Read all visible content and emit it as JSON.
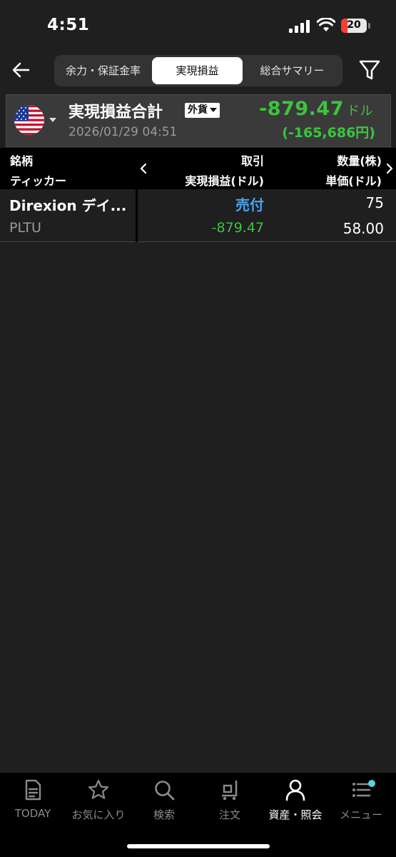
{
  "status_bar": {
    "time": "4:51",
    "battery": "20"
  },
  "tabs": [
    {
      "label": "余力・保証金率"
    },
    {
      "label": "実現損益"
    },
    {
      "label": "総合サマリー"
    }
  ],
  "summary": {
    "title": "実現損益合計",
    "currency_badge": "外貨",
    "date": "2026/01/29 04:51",
    "pl_usd": "-879.47",
    "pl_usd_unit": "ドル",
    "pl_jpy": "(-165,686円)"
  },
  "table": {
    "headers": {
      "col1_top": "銘柄",
      "col1_bottom": "ティッカー",
      "col2_top": "取引",
      "col2_bottom": "実現損益(ドル)",
      "col3_top": "数量(株)",
      "col3_bottom": "単価(ドル)"
    },
    "rows": [
      {
        "name": "Direxion デイ...",
        "ticker": "PLTU",
        "trade": "売付",
        "pl": "-879.47",
        "qty": "75",
        "price": "58.00"
      }
    ]
  },
  "bottom_nav": [
    {
      "label": "TODAY",
      "icon": "document-icon"
    },
    {
      "label": "お気に入り",
      "icon": "star-icon"
    },
    {
      "label": "検索",
      "icon": "search-icon"
    },
    {
      "label": "注文",
      "icon": "cart-icon"
    },
    {
      "label": "資産・照会",
      "icon": "person-icon"
    },
    {
      "label": "メニュー",
      "icon": "menu-icon"
    }
  ],
  "colors": {
    "positive_green": "#3dc43d",
    "trade_blue": "#4aa3f0",
    "badge_dot": "#5ad1e6"
  }
}
